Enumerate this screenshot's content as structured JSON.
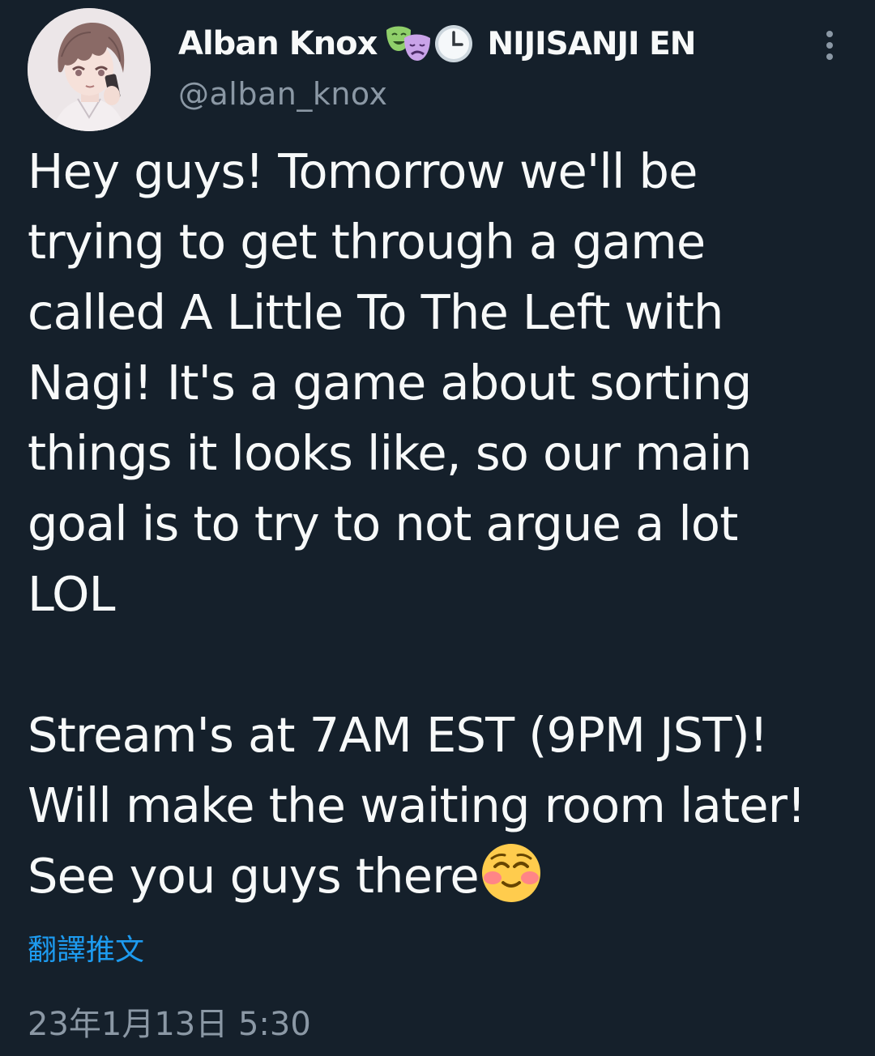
{
  "tweet": {
    "display_name": "Alban Knox",
    "name_suffix": "NIJISANJI EN",
    "handle": "@alban_knox",
    "body_paragraph_1": "Hey guys! Tomorrow we'll be\ntrying to get through a game\ncalled A Little To The Left with\nNagi! It's a game about sorting\nthings it looks like, so our main\ngoal is to try to not argue a lot\nLOL",
    "body_paragraph_2_lines": "Stream's at 7AM EST (9PM JST)!\nWill make the waiting room later!\n",
    "body_paragraph_2_last": "See you guys there",
    "translate_label": "翻譯推文",
    "timestamp": "23年1月13日 5:30"
  },
  "icons": {
    "name_emoji_1": "performing-arts-masks-icon",
    "name_emoji_2": "clock-icon",
    "body_emoji": "smiling-face-with-blush-icon",
    "more_menu": "more-vertical-icon"
  },
  "colors": {
    "background": "#15202b",
    "text": "#f7f9f9",
    "secondary_text": "#8b98a5",
    "link": "#1d9bf0"
  }
}
